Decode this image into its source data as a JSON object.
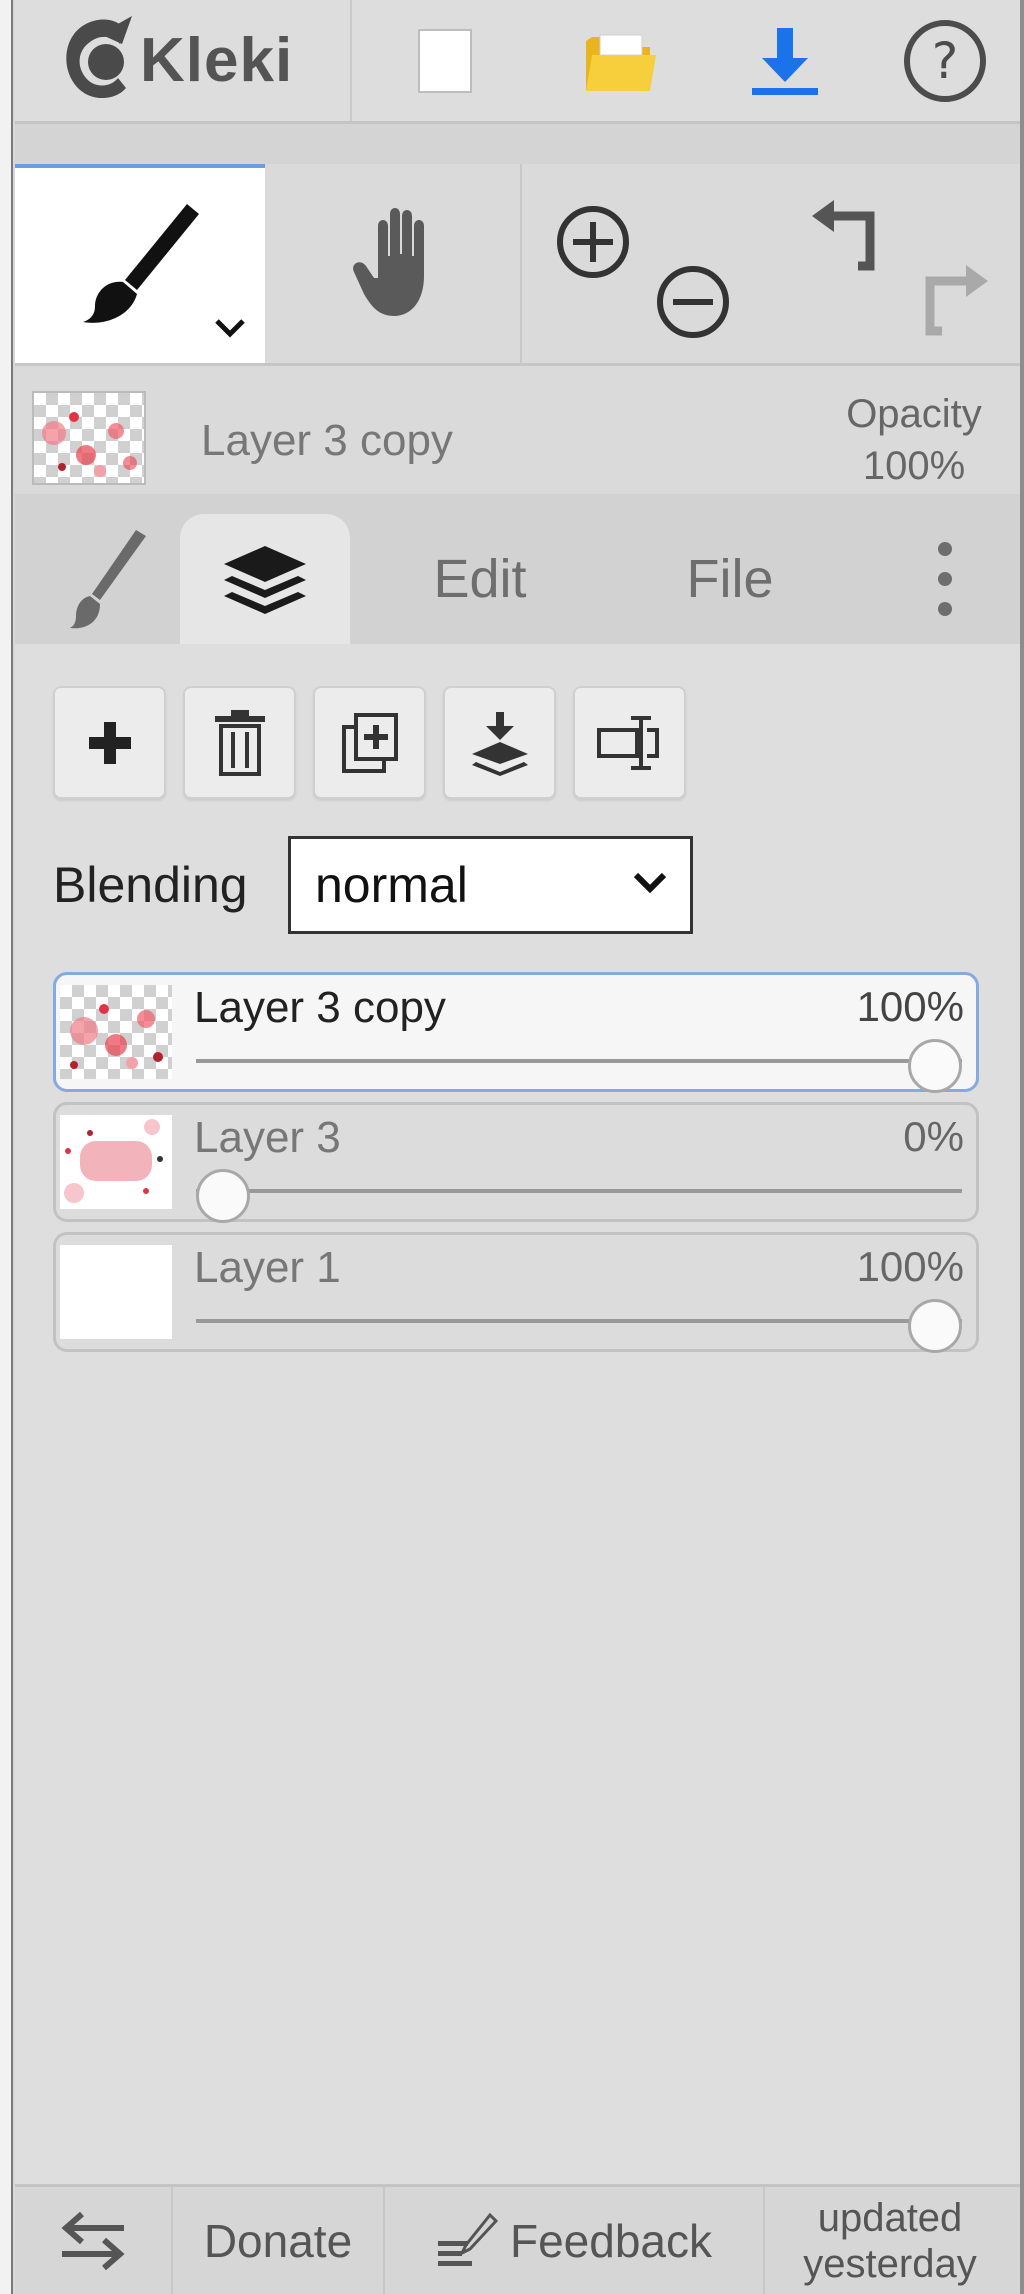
{
  "app": {
    "logo_text": "Kleki"
  },
  "toolbar": {
    "buttons": [
      {
        "name": "new",
        "icon": "new-file-icon"
      },
      {
        "name": "open",
        "icon": "folder-icon"
      },
      {
        "name": "save",
        "icon": "download-icon"
      },
      {
        "name": "help",
        "icon": "help-icon"
      }
    ]
  },
  "tools": {
    "brush": {
      "icon": "brush-icon",
      "active": true
    },
    "hand": {
      "icon": "hand-icon"
    },
    "zoom_in": {
      "icon": "zoom-in-icon"
    },
    "zoom_out": {
      "icon": "zoom-out-icon"
    },
    "undo": {
      "icon": "undo-icon"
    },
    "redo": {
      "icon": "redo-icon"
    }
  },
  "current_layer": {
    "name": "Layer 3 copy",
    "opacity_label": "Opacity",
    "opacity_value": "100%"
  },
  "tabs": [
    {
      "id": "brush",
      "icon": "brush-icon"
    },
    {
      "id": "layers",
      "icon": "layers-icon",
      "active": true
    },
    {
      "id": "edit",
      "label": "Edit"
    },
    {
      "id": "file",
      "label": "File"
    },
    {
      "id": "more",
      "icon": "more-vertical-icon"
    }
  ],
  "layers_panel": {
    "actions": [
      {
        "name": "add-layer",
        "icon": "plus-icon"
      },
      {
        "name": "delete-layer",
        "icon": "trash-icon"
      },
      {
        "name": "duplicate-layer",
        "icon": "duplicate-icon"
      },
      {
        "name": "merge-layer",
        "icon": "merge-down-icon"
      },
      {
        "name": "rename-layer",
        "icon": "rename-icon"
      }
    ],
    "blending_label": "Blending",
    "blending_value": "normal",
    "layers": [
      {
        "name": "Layer 3 copy",
        "opacity_text": "100%",
        "opacity": 1.0,
        "active": true
      },
      {
        "name": "Layer 3",
        "opacity_text": "0%",
        "opacity": 0.0,
        "active": false
      },
      {
        "name": "Layer 1",
        "opacity_text": "100%",
        "opacity": 1.0,
        "active": false
      }
    ]
  },
  "footer": {
    "swap_icon": "swap-icon",
    "donate": "Donate",
    "feedback": "Feedback",
    "feedback_icon": "feedback-icon",
    "updated_line1": "updated",
    "updated_line2": "yesterday"
  },
  "colors": {
    "accent_blue": "#1a73e8",
    "folder_yellow": "#f5c22a",
    "active_border": "#86a9e0"
  }
}
